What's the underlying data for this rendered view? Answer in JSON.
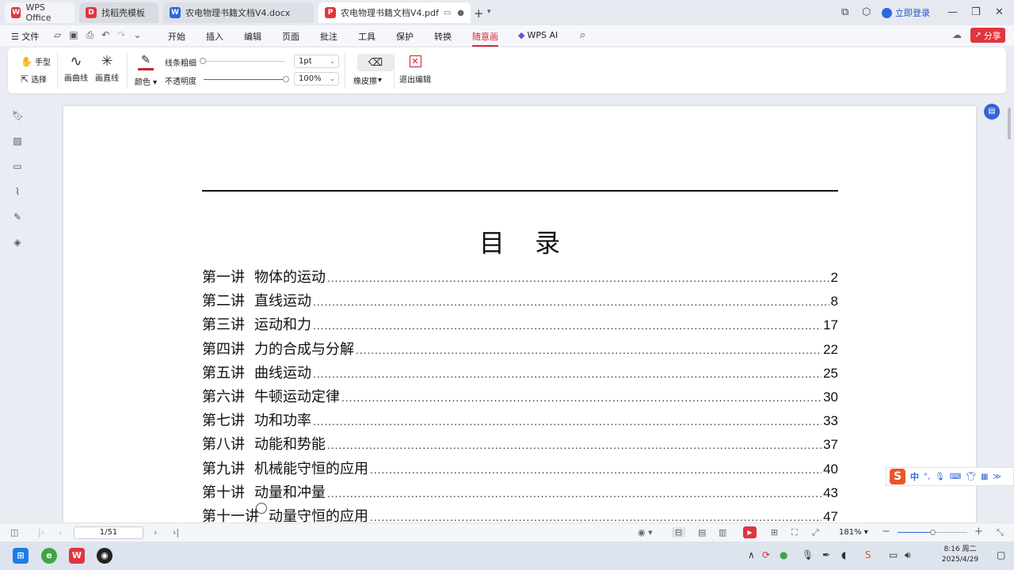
{
  "tabs": {
    "wps": "WPS Office",
    "template": "找稻壳模板",
    "docx": "农电物理书籍文档V4.docx",
    "pdf": "农电物理书籍文档V4.pdf"
  },
  "account": {
    "login": "立即登录"
  },
  "menu": {
    "file": "文件",
    "items": [
      "开始",
      "插入",
      "编辑",
      "页面",
      "批注",
      "工具",
      "保护",
      "转换",
      "随意画"
    ],
    "active_index": 8,
    "wps_ai": "WPS AI",
    "share": "分享"
  },
  "draw_toolbar": {
    "hand": "手型",
    "select": "选择",
    "curve": "画曲线",
    "line": "画直线",
    "color": "颜色",
    "line_width_label": "线条粗细",
    "line_width_value": "1pt",
    "line_width_fraction": 0.0,
    "opacity_label": "不透明度",
    "opacity_value": "100%",
    "opacity_fraction": 1.0,
    "eraser": "橡皮擦",
    "exit": "退出编辑",
    "pen_color": "#d0202f"
  },
  "document": {
    "title": "目 录",
    "toc": [
      {
        "chapter": "第一讲",
        "title": "物体的运动",
        "page": "2"
      },
      {
        "chapter": "第二讲",
        "title": "直线运动",
        "page": "8"
      },
      {
        "chapter": "第三讲",
        "title": "运动和力",
        "page": "17"
      },
      {
        "chapter": "第四讲",
        "title": "力的合成与分解",
        "page": "22"
      },
      {
        "chapter": "第五讲",
        "title": "曲线运动",
        "page": "25"
      },
      {
        "chapter": "第六讲",
        "title": "牛顿运动定律",
        "page": "30"
      },
      {
        "chapter": "第七讲",
        "title": "功和功率",
        "page": "33"
      },
      {
        "chapter": "第八讲",
        "title": "动能和势能",
        "page": "37"
      },
      {
        "chapter": "第九讲",
        "title": "机械能守恒的应用",
        "page": "40"
      },
      {
        "chapter": "第十讲",
        "title": "动量和冲量",
        "page": "43"
      },
      {
        "chapter": "第十一讲",
        "title": "动量守恒的应用",
        "page": "47"
      }
    ]
  },
  "ime": {
    "mode": "中"
  },
  "status": {
    "page": "1/51",
    "zoom": "181%",
    "zoom_fraction": 0.5
  },
  "clock": {
    "time": "8:16 周二",
    "date": "2025/4/29"
  },
  "colors": {
    "accent": "#d12b3a",
    "primary": "#2f66dd"
  }
}
